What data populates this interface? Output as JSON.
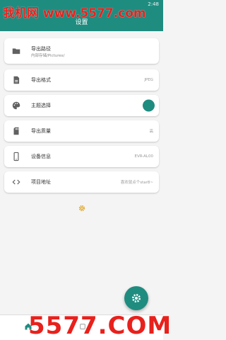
{
  "status_bar": {
    "time": "2:48"
  },
  "watermark_top": "我机网 www.5577.com",
  "appbar": {
    "title": "设置"
  },
  "settings": [
    {
      "label": "导出路径",
      "sub": "内部存储/Pictures/"
    },
    {
      "label": "导出格式",
      "value": "JPEG"
    },
    {
      "label": "主题选择"
    },
    {
      "label": "导出质量",
      "value": "高"
    },
    {
      "label": "设备信息",
      "value": "EVR-AL00"
    },
    {
      "label": "项目地址",
      "value": "喜欢就点个star8~"
    }
  ],
  "colors": {
    "accent": "#1f8c80",
    "watermark": "#e8211c"
  },
  "icons": [
    "folder-icon",
    "file-icon",
    "palette-icon",
    "sd-card-icon",
    "phone-icon",
    "code-icon",
    "gear-icon",
    "home-icon"
  ],
  "watermark_bottom": "5577.COM"
}
